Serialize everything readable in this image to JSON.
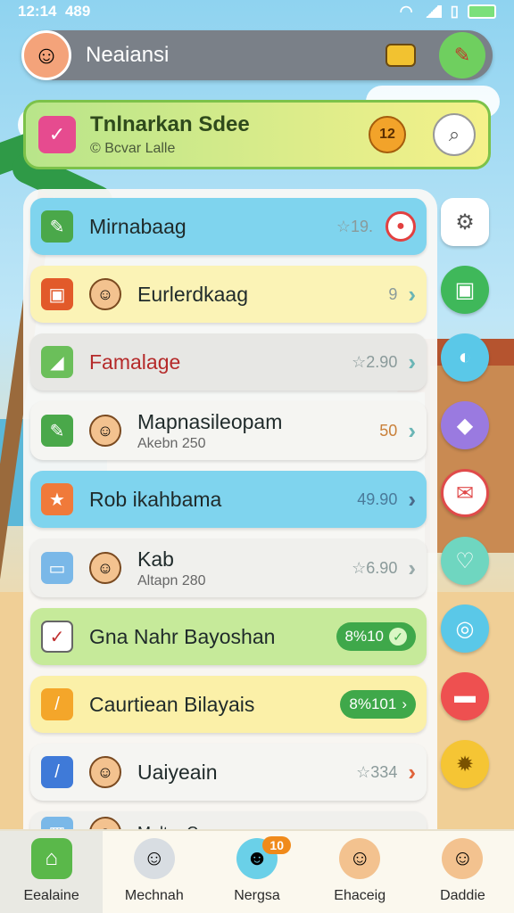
{
  "status_bar": {
    "time": "12:14",
    "extra": "489"
  },
  "header": {
    "title": "Neaiansi"
  },
  "banner": {
    "title": "Tnlnarkan Sdee",
    "subtitle": "© Bcvar Lalle",
    "badge": "12"
  },
  "list": [
    {
      "label": "Mirnabaag",
      "value": "☆19.",
      "style": "blue"
    },
    {
      "label": "Eurlerdkaag",
      "value": "9",
      "style": "yellow"
    },
    {
      "label": "Famalage",
      "value": "☆2.90",
      "style": "grey"
    },
    {
      "label": "Mapnasileopam",
      "sub": "Akebn 250",
      "value": "50",
      "style": "white"
    },
    {
      "label": "Rob ikahbama",
      "value": "49.90",
      "style": "blue"
    },
    {
      "label": "Kab",
      "sub": "Altapn 280",
      "value": "☆6.90",
      "style": "white"
    },
    {
      "label": "Gna Nahr Bayoshan",
      "value": "8%10",
      "style": "green"
    },
    {
      "label": "Caurtiean Bilayais",
      "value": "8%101",
      "style": "yellow"
    },
    {
      "label": "Uaiyeain",
      "value": "☆334",
      "style": "white"
    },
    {
      "label": "Malter Ca",
      "sub": "",
      "value": "",
      "style": "white"
    }
  ],
  "bottom_nav": [
    {
      "label": "Eealaine"
    },
    {
      "label": "Mechnah"
    },
    {
      "label": "Nergsa",
      "badge": "10"
    },
    {
      "label": "Ehaceig"
    },
    {
      "label": "Daddie"
    }
  ]
}
